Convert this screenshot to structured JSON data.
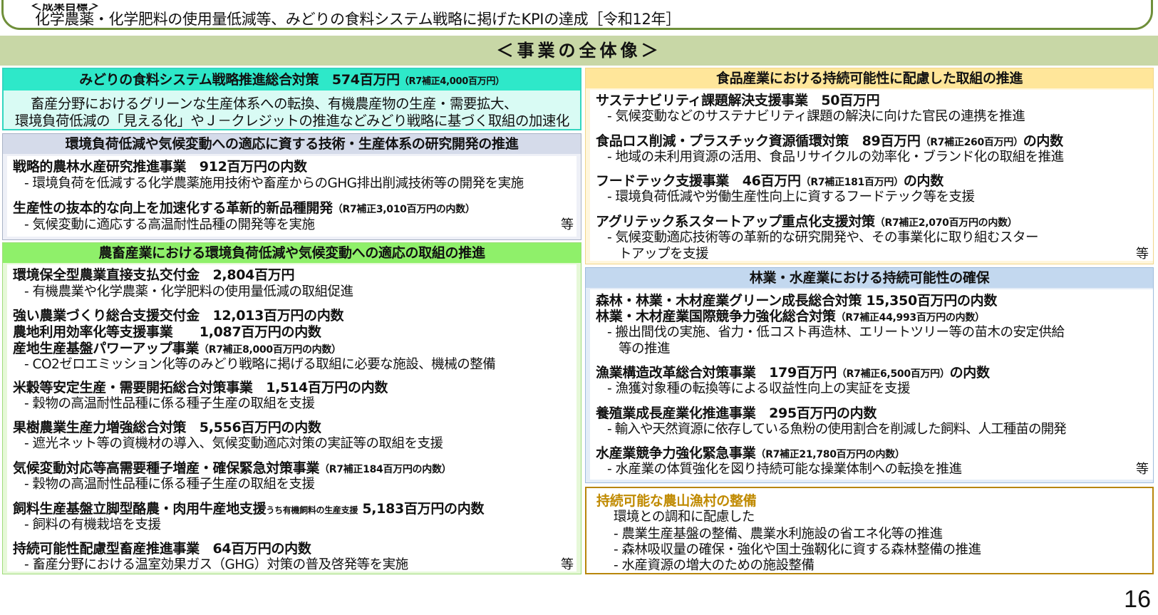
{
  "objective": {
    "label": "＜成果目標＞",
    "text": "化学農薬・化学肥料の使用量低減等、みどりの食料システム戦略に掲げたKPIの達成［令和12年］"
  },
  "overview_title": "＜事業の全体像＞",
  "left": {
    "midori": {
      "title": "みどりの食料システム戦略推進総合対策　574百万円",
      "title_note": "（R7補正4,000百万円）",
      "desc1": "畜産分野におけるグリーンな生産体系への転換、有機農産物の生産・需要拡大、",
      "desc2": "環境負荷低減の「見える化」やＪ－クレジットの推進などみどり戦略に基づく取組の加速化"
    },
    "research": {
      "header": "環境負荷低減や気候変動への適応に資する技術・生産体系の研究開発の推進",
      "item1_title": "戦略的農林水産研究推進事業　912百万円の内数",
      "item1_desc": "- 環境負荷を低減する化学農薬施用技術や畜産からのGHG排出削減技術等の開発を実施",
      "item2_title": "生産性の抜本的な向上を加速化する革新的新品種開発",
      "item2_note": "（R7補正3,010百万円の内数）",
      "item2_desc": "- 気候変動に適応する高温耐性品種の開発等を実施",
      "etc": "等"
    },
    "agri": {
      "header": "農畜産業における環境負荷低減や気候変動への適応の取組の推進",
      "items": [
        {
          "title": "環境保全型農業直接支払交付金　2,804百万円",
          "desc": "- 有機農業や化学農薬・化学肥料の使用量低減の取組促進"
        },
        {
          "title": "強い農業づくり総合支援交付金　12,013百万円の内数"
        },
        {
          "title": "農地利用効率化等支援事業　　1,087百万円の内数"
        },
        {
          "title": "産地生産基盤パワーアップ事業",
          "note": "（R7補正8,000百万円の内数）",
          "desc": "- CO2ゼロエミッション化等のみどり戦略に掲げる取組に必要な施設、機械の整備"
        },
        {
          "title": "米穀等安定生産・需要開拓総合対策事業　1,514百万円の内数",
          "desc": "- 穀物の高温耐性品種に係る種子生産の取組を支援"
        },
        {
          "title": "果樹農業生産力増強総合対策　5,556百万円の内数",
          "desc": "- 遮光ネット等の資機材の導入、気候変動適応対策の実証等の取組を支援"
        },
        {
          "title": "気候変動対応等高需要種子増産・確保緊急対策事業",
          "note": "（R7補正184百万円の内数）",
          "desc": "- 穀物の高温耐性品種に係る種子生産の取組を支援"
        },
        {
          "title": "飼料生産基盤立脚型酪農・肉用牛産地支援",
          "note": "うち有機飼料の生産支援",
          "title2": "5,183百万円の内数",
          "desc": "- 飼料の有機栽培を支援"
        },
        {
          "title": "持続可能性配慮型畜産推進事業　64百万円の内数",
          "desc": "- 畜産分野における温室効果ガス（GHG）対策の普及啓発等を実施"
        }
      ],
      "etc": "等"
    }
  },
  "right": {
    "food": {
      "header": "食品産業における持続可能性に配慮した取組の推進",
      "items": [
        {
          "title": "サステナビリティ課題解決支援事業　50百万円",
          "desc": "- 気候変動などのサステナビリティ課題の解決に向けた官民の連携を推進"
        },
        {
          "title": "食品ロス削減・プラスチック資源循環対策　89百万円",
          "note": "（R7補正260百万円）",
          "title2": "の内数",
          "desc": "- 地域の未利用資源の活用、食品リサイクルの効率化・ブランド化の取組を推進"
        },
        {
          "title": "フードテック支援事業　46百万円",
          "note": "（R7補正181百万円）",
          "title2": "の内数",
          "desc": "- 環境負荷低減や労働生産性向上に資するフードテック等を支援"
        },
        {
          "title": "アグリテック系スタートアップ重点化支援対策",
          "note": "（R7補正2,070百万円の内数）",
          "desc": "- 気候変動適応技術等の革新的な研究開発や、その事業化に取り組むスター",
          "desc2": "トアップを支援"
        }
      ],
      "etc": "等"
    },
    "forest": {
      "header": "林業・水産業における持続可能性の確保",
      "items": [
        {
          "title": "森林・林業・木材産業グリーン成長総合対策 15,350百万円の内数"
        },
        {
          "title": "林業・木材産業国際競争力強化総合対策",
          "note": "（R7補正44,993百万円の内数）",
          "desc": "- 搬出間伐の実施、省力・低コスト再造林、エリートツリー等の苗木の安定供給",
          "desc2": "等の推進"
        },
        {
          "title": "漁業構造改革総合対策事業　179百万円",
          "note": "（R7補正6,500百万円）",
          "title2": "の内数",
          "desc": "- 漁獲対象種の転換等による収益性向上の実証を支援"
        },
        {
          "title": "養殖業成長産業化推進事業　295百万円の内数",
          "desc": "- 輸入や天然資源に依存している魚粉の使用割合を削減した飼料、人工種苗の開発"
        },
        {
          "title": "水産業競争力強化緊急事業",
          "note": "（R7補正21,780百万円の内数）",
          "desc": "- 水産業の体質強化を図り持続可能な操業体制への転換を推進"
        }
      ],
      "etc": "等"
    },
    "rural": {
      "title": "持続可能な農山漁村の整備",
      "intro": "環境との調和に配慮した",
      "items": [
        "- 農業生産基盤の整備、農業水利施設の省エネ化等の推進",
        "- 森林吸収量の確保・強化や国土強靱化に資する森林整備の推進",
        "- 水産資源の増大のための施設整備"
      ]
    }
  },
  "page_number": "16"
}
